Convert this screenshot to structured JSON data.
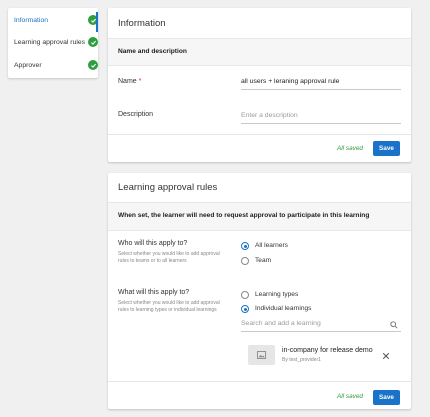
{
  "nav": {
    "items": [
      {
        "label": "Information",
        "active": true
      },
      {
        "label": "Learning approval rules",
        "active": false
      },
      {
        "label": "Approver",
        "active": false
      }
    ]
  },
  "info": {
    "title": "Information",
    "section_label": "Name and description",
    "name_label": "Name",
    "name_required_mark": "*",
    "name_value": "all users + leraning approval rule",
    "description_label": "Description",
    "description_placeholder": "Enter a description",
    "saved_status": "All saved",
    "save_label": "Save"
  },
  "rules": {
    "title": "Learning approval rules",
    "notice": "When set, the learner will need to request approval to participate in this learning",
    "who": {
      "title": "Who will this apply to?",
      "description": "Select whether you would like to add approval rules to teams or to all learners",
      "options": [
        {
          "label": "All learners",
          "selected": true
        },
        {
          "label": "Team",
          "selected": false
        }
      ]
    },
    "what": {
      "title": "What will this apply to?",
      "description": "Select whether you would like to add approval rules to learning types or individual learnings",
      "options": [
        {
          "label": "Learning types",
          "selected": false
        },
        {
          "label": "Individual learnings",
          "selected": true
        }
      ]
    },
    "search_placeholder": "Search and add a learning",
    "selected_learning": {
      "title": "in-company for release demo",
      "provider": "By test_provider1"
    },
    "saved_status": "All saved",
    "save_label": "Save"
  },
  "colors": {
    "accent": "#1a73c8",
    "success": "#2e9e3f",
    "required": "#d32f2f"
  },
  "icons": {
    "check": "check-circle-icon",
    "search": "search-icon",
    "close": "close-icon",
    "thumbnail": "image-icon"
  }
}
